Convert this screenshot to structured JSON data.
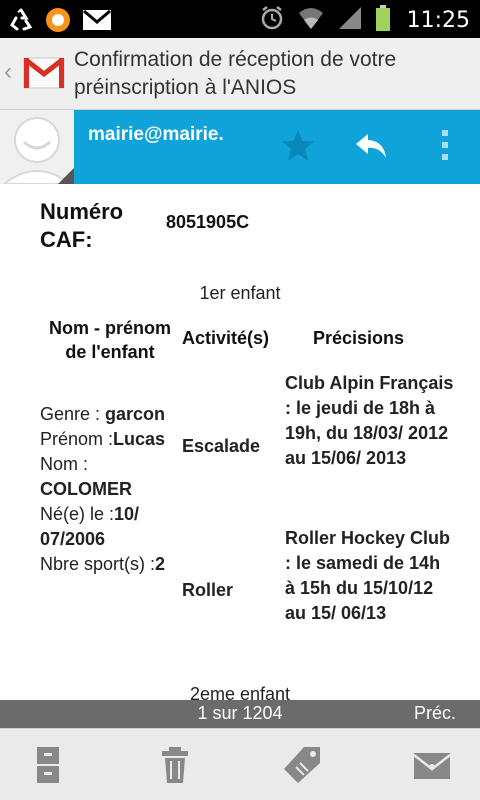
{
  "status_bar": {
    "time": "11:25",
    "icons": [
      "recycle-icon",
      "orange-notification-icon",
      "gmail-notification-icon",
      "alarm-icon",
      "wifi-icon",
      "signal-icon",
      "battery-icon"
    ]
  },
  "header": {
    "subject": "Confirmation de réception de votre préinscription à l'ANIOS",
    "app_icon": "gmail-icon"
  },
  "sender": {
    "email": "mairie@mairie.",
    "bar_color": "#0fa3d9"
  },
  "body": {
    "caf_label": "Numéro CAF:",
    "caf_value": "8051905C",
    "child1_title": "1er enfant",
    "table_headers": {
      "name": "Nom - prénom de l'enfant",
      "activity": "Activité(s)",
      "details": "Précisions"
    },
    "child_info": {
      "genre_label": "Genre : ",
      "genre_value": "garcon",
      "prenom_label": "Prénom :",
      "prenom_value": "Lucas",
      "nom_label": "Nom : ",
      "nom_value": "COLOMER",
      "ne_label": "Né(e) le :",
      "ne_value": "10/ 07/2006",
      "sports_label": "Nbre sport(s) :",
      "sports_value": "2"
    },
    "activities": [
      {
        "name": "Escalade",
        "details": "Club Alpin Français : le jeudi de 18h à 19h, du 18/03/ 2012 au 15/06/ 2013"
      },
      {
        "name": "Roller",
        "details": "Roller Hockey Club : le samedi de 14h à 15h du 15/10/12 au 15/ 06/13"
      }
    ],
    "child2_title": "2eme enfant"
  },
  "pager": {
    "count": "1 sur 1204",
    "prev": "Préc."
  },
  "bottom_bar": {
    "icons": [
      "archive-icon",
      "delete-icon",
      "labels-icon",
      "mark-unread-icon"
    ]
  }
}
